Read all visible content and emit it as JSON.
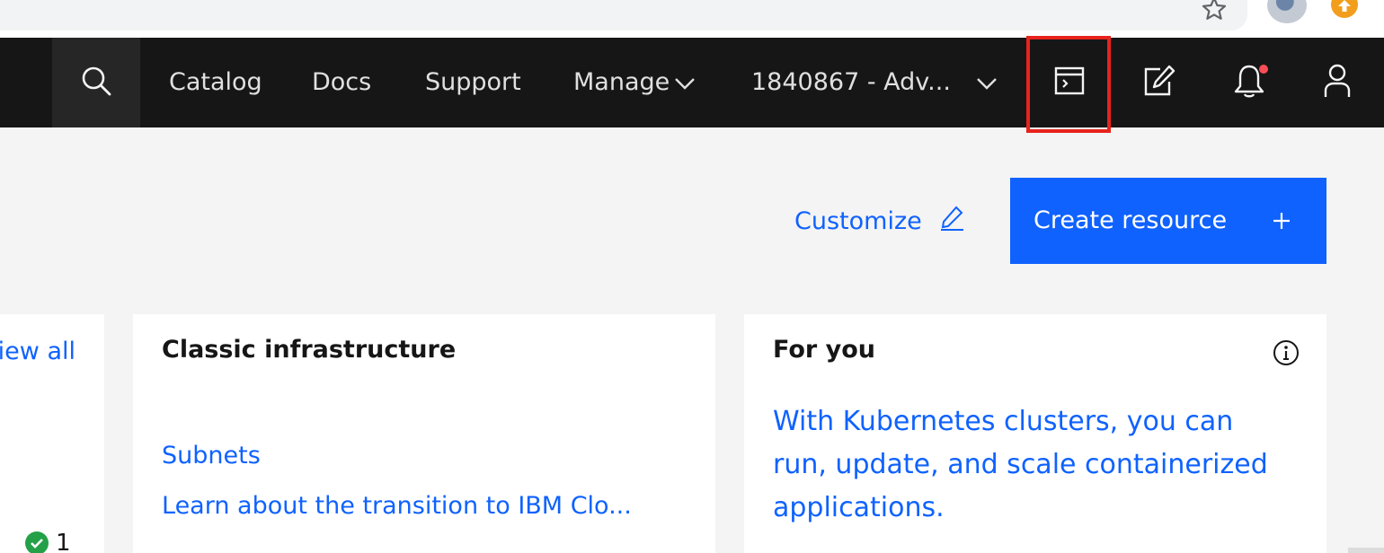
{
  "masthead": {
    "nav": {
      "catalog": "Catalog",
      "docs": "Docs",
      "support": "Support",
      "manage": "Manage",
      "account": "1840867 - Adv..."
    }
  },
  "actions": {
    "customize": "Customize",
    "create_resource": "Create resource"
  },
  "tiles": {
    "left": {
      "view_all": "View all",
      "status_count": "1"
    },
    "classic": {
      "title": "Classic infrastructure",
      "links": [
        "Subnets",
        "Learn about the transition to IBM Clo..."
      ]
    },
    "for_you": {
      "title": "For you",
      "body": "With Kubernetes clusters, you can run, update, and scale containerized applications."
    }
  },
  "colors": {
    "masthead_bg": "#161616",
    "accent_blue": "#0f62fe",
    "highlight_red": "#e8231d",
    "notification_red": "#fa4d56",
    "success_green": "#24a148"
  },
  "icons": [
    "search-icon",
    "chevron-down-icon",
    "terminal-icon",
    "edit-icon",
    "notification-bell-icon",
    "user-icon",
    "pencil-icon",
    "plus-icon",
    "info-icon",
    "checkmark-icon",
    "star-icon"
  ]
}
